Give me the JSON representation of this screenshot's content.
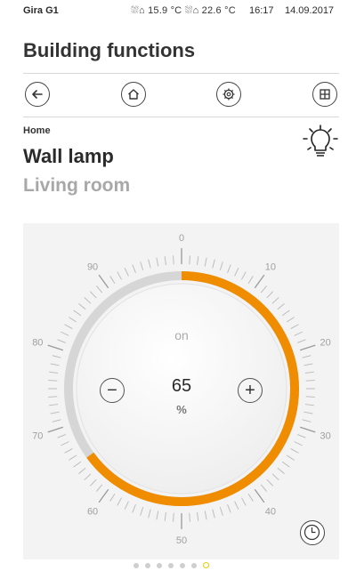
{
  "status_bar": {
    "brand": "Gira G1",
    "temperatures": "⛆⌂ 15.9 °C  ⛆⌂ 22.6 °C",
    "time": "16:17",
    "date": "14.09.2017"
  },
  "header": {
    "title": "Building functions"
  },
  "nav": {
    "icons": [
      "back-arrow-icon",
      "home-icon",
      "settings-gear-icon",
      "grid-icon"
    ]
  },
  "device": {
    "breadcrumb": "Home",
    "name": "Wall lamp",
    "room": "Living room",
    "icon": "lamp-bulb-icon"
  },
  "dimmer": {
    "state": "on",
    "value": "65",
    "unit": "%",
    "level_percent": 65,
    "scale_labels": [
      "0",
      "10",
      "20",
      "30",
      "40",
      "50",
      "60",
      "70",
      "80",
      "90"
    ],
    "accent_color": "#f08c00",
    "track_color": "#d6d6d6",
    "minus_label": "−",
    "plus_label": "+"
  },
  "pager": {
    "page_count": 7,
    "active_page": 7
  }
}
